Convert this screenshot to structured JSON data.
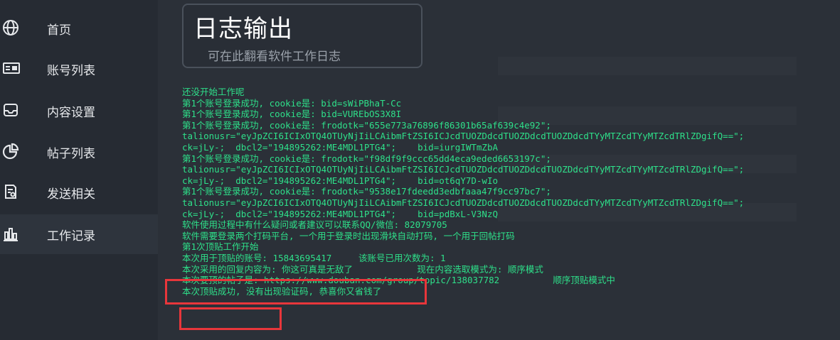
{
  "nav": {
    "items": [
      {
        "label": "首页",
        "icon": "globe-icon"
      },
      {
        "label": "账号列表",
        "icon": "id-card-icon"
      },
      {
        "label": "内容设置",
        "icon": "inbox-icon"
      },
      {
        "label": "帖子列表",
        "icon": "pie-chart-icon"
      },
      {
        "label": "发送相关",
        "icon": "document-icon"
      },
      {
        "label": "工作记录",
        "icon": "bar-chart-icon"
      }
    ],
    "active_index": 5
  },
  "header": {
    "title": "日志输出",
    "subtitle": "可在此翻看软件工作日志"
  },
  "log": {
    "lines": [
      "还没开始工作呢",
      "第1个账号登录成功, cookie是: bid=sWiPBhaT-Cc",
      "第1个账号登录成功, cookie是: bid=VUREbOS3X8I",
      "第1个账号登录成功, cookie是: frodotk=\"655e773a76896f86301b65af639c4e92\";",
      "talionusr=\"eyJpZCI6ICIxOTQ4OTUyNjIiLCAibmFtZSI6ICJcdTUOZDdcdTUOZDdcdTUOZDdcdTYyMTZcdTYyMTZcdTRlZDgifQ==\";",
      "ck=jLy-;  dbcl2=\"194895262:ME4MDL1PTG4\";    bid=iurgIWTmZbA",
      "第1个账号登录成功, cookie是: frodotk=\"f98df9f9ccc65dd4eca9eded6653197c\";",
      "talionusr=\"eyJpZCI6ICIxOTQ4OTUyNjIiLCAibmFtZSI6ICJcdTUOZDdcdTUOZDdcdTUOZDdcdTYyMTZcdTYyMTZcdTRlZDgifQ==\";",
      "ck=jLy-;  dbcl2=\"194895262:ME4MDL1PTG4\";    bid=ot6qY7D-wIo",
      "第1个账号登录成功, cookie是: frodotk=\"9538e17fdeedd3edbfaaa47f9cc97bc7\";",
      "talionusr=\"eyJpZCI6ICIxOTQ4OTUyNjIiLCAibmFtZSI6ICJcdTUOZDdcdTUOZDdcdTUOZDdcdTYyMTZcdTYyMTZcdTRlZDgifQ==\";",
      "ck=jLy-;  dbcl2=\"194895262:ME4MDL1PTG4\";    bid=pdBxL-V3NzQ",
      "软件使用过程中有什么疑问或者建议可以联系QQ/微信: 82079705",
      "软件需要登录两个打码平台, 一个用于登录时出现滑块自动打码, 一个用于回帖打码",
      "第1次顶贴工作开始",
      "本次用于顶贴的账号: 15843695417     该账号已用次数为: 1",
      "本次采用的回复内容为: 你这可真是无敌了            现在内容选取模式为: 顺序模式",
      "本次要顶的帖子是: https://www.douban.com/group/topic/138037782          顺序顶贴模式中",
      "本次顶贴成功, 没有出现验证码, 恭喜你又省钱了"
    ]
  },
  "colors": {
    "log_text": "#2ee08a",
    "highlight": "#e8363b",
    "background": "#2b3038"
  }
}
